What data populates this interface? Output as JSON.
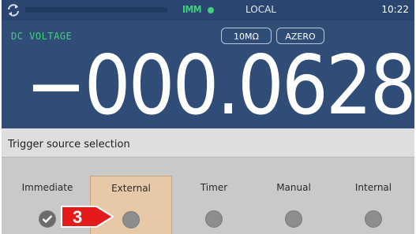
{
  "status_bar": {
    "mode": "IMM",
    "location": "LOCAL",
    "time": "10:22"
  },
  "measurement": {
    "function": "DC VOLTAGE",
    "range_chip": "10MΩ",
    "azero_chip": "AZERO",
    "reading": "−000.0628"
  },
  "trigger_menu": {
    "title": "Trigger source selection",
    "options": [
      {
        "label": "Immediate",
        "checked": true
      },
      {
        "label": "External",
        "highlighted": true
      },
      {
        "label": "Timer"
      },
      {
        "label": "Manual"
      },
      {
        "label": "Internal"
      }
    ]
  },
  "callout": {
    "number": "3"
  },
  "colors": {
    "screen_bg": "#2f4d77",
    "accent_green": "#3fd07a",
    "menu_bg": "#c9c9c9",
    "selected_option": "#e7c9a7",
    "callout_red": "#e51a1a"
  }
}
